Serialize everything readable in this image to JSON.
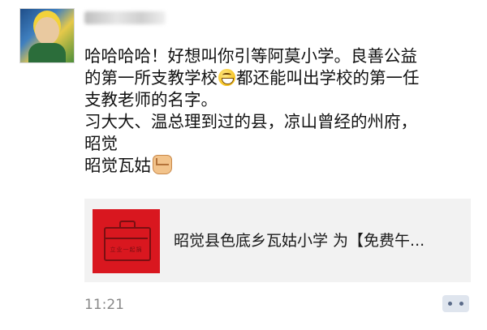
{
  "post": {
    "author": {
      "avatar_icon": "user-avatar"
    },
    "message_lines": [
      "哈哈哈哈！好想叫你引等阿莫小学。良善公益",
      "的第一所支教学校",
      "都还能叫出学校的第一任",
      "支教老师的名字。",
      "习大大、温总理到过的县，凉山曾经的州府，",
      "昭觉",
      "昭觉瓦姑"
    ],
    "emojis": [
      "grinning-face-icon",
      "raised-fist-icon"
    ],
    "share_card": {
      "title": "昭觉县色底乡瓦姑小学 为【免费午...",
      "thumbnail_caption": "立业一起捐",
      "thumbnail_color": "#d9171f"
    },
    "timestamp": "11:21",
    "more_icon": "more-dots-icon"
  }
}
